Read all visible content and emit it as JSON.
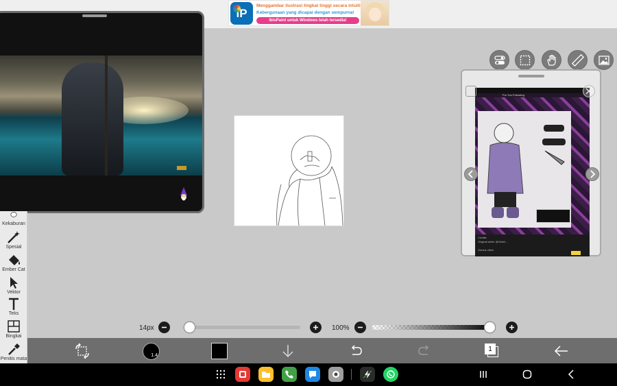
{
  "ad": {
    "logo_text": "iP",
    "line1": "Menggambar ilustrasi tingkat tinggi secara intuitif!",
    "line2": "Kebergunaan yang dicapai dengan sempurna!",
    "line3": "ibisPaint untuk Windows telah tersedia!"
  },
  "left_toolbar": {
    "items": [
      {
        "label": "Kekaburan",
        "icon": "blur-icon"
      },
      {
        "label": "Spesial",
        "icon": "magic-wand-icon"
      },
      {
        "label": "Ember Cat",
        "icon": "paint-bucket-icon"
      },
      {
        "label": "Vektor",
        "icon": "cursor-arrow-icon"
      },
      {
        "label": "Teks",
        "icon": "text-icon"
      },
      {
        "label": "Bingkai",
        "icon": "frame-icon"
      },
      {
        "label": "Penitis mata",
        "icon": "eyedropper-icon"
      }
    ]
  },
  "top_right_tools": [
    {
      "name": "toggle-icon"
    },
    {
      "name": "selection-icon"
    },
    {
      "name": "hand-icon"
    },
    {
      "name": "ruler-icon"
    },
    {
      "name": "image-icon"
    }
  ],
  "sliders": {
    "brush_size_label": "14px",
    "brush_size_value": 0,
    "opacity_label": "100%",
    "opacity_value": 100
  },
  "bottom_toolbar": {
    "brush_size_text": "1.4",
    "current_color": "#000000",
    "layer_count": "1"
  },
  "reference_window": {
    "status_tabs": "For You   Following",
    "caption_line1": "Credits",
    "caption_line2": "Original artist: @Violet...",
    "caption_line3": "Genius vibes"
  },
  "colors": {
    "toolbar_bg": "#6e6e6e",
    "workspace_bg": "#c9c9c9",
    "ad_pink": "#e83d8b"
  }
}
